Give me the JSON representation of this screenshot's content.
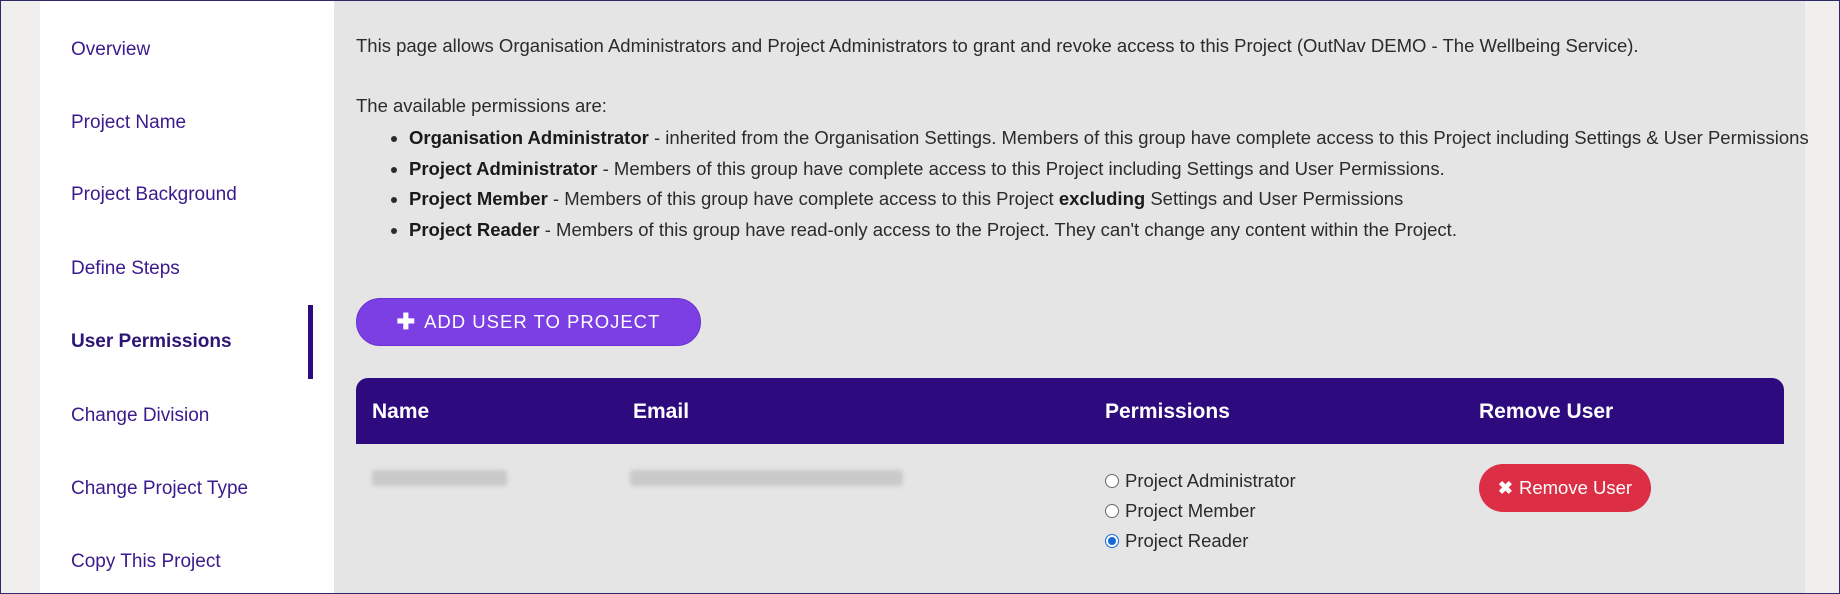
{
  "sidebar": {
    "items": [
      {
        "label": "Overview"
      },
      {
        "label": "Project Name"
      },
      {
        "label": "Project Background"
      },
      {
        "label": "Define Steps"
      },
      {
        "label": "User Permissions"
      },
      {
        "label": "Change Division"
      },
      {
        "label": "Change Project Type"
      },
      {
        "label": "Copy This Project"
      }
    ],
    "active_item": "User Permissions"
  },
  "main": {
    "intro": "This page allows Organisation Administrators and Project Administrators to grant and revoke access to this Project (OutNav DEMO - The Wellbeing Service).",
    "available_heading": "The available permissions are:",
    "permissions": [
      {
        "title": "Organisation Administrator",
        "desc": " - inherited from the Organisation Settings. Members of this group have complete access to this Project including Settings & User Permissions"
      },
      {
        "title": "Project Administrator",
        "desc": " - Members of this group have complete access to this Project including Settings and User Permissions."
      },
      {
        "title": "Project Member",
        "desc_before": " - Members of this group have complete access to this Project ",
        "emphasis": "excluding",
        "desc_after": " Settings and User Permissions"
      },
      {
        "title": "Project Reader",
        "desc": " - Members of this group have read-only access to the Project. They can't change any content within the Project."
      }
    ],
    "add_button": {
      "icon": "plus-icon",
      "label": "ADD USER TO PROJECT"
    },
    "table": {
      "headers": {
        "name": "Name",
        "email": "Email",
        "permissions": "Permissions",
        "remove": "Remove User"
      },
      "rows": [
        {
          "permission_options": [
            "Project Administrator",
            "Project Member",
            "Project Reader"
          ],
          "selected_permission": "Project Reader",
          "remove_button": {
            "icon": "close-icon",
            "label": "Remove User"
          }
        }
      ]
    }
  },
  "colors": {
    "accent_dark": "#2d0a7d",
    "accent_purple": "#7b3fe4",
    "danger": "#dc2f45",
    "nav_text": "#3a1a8c"
  }
}
